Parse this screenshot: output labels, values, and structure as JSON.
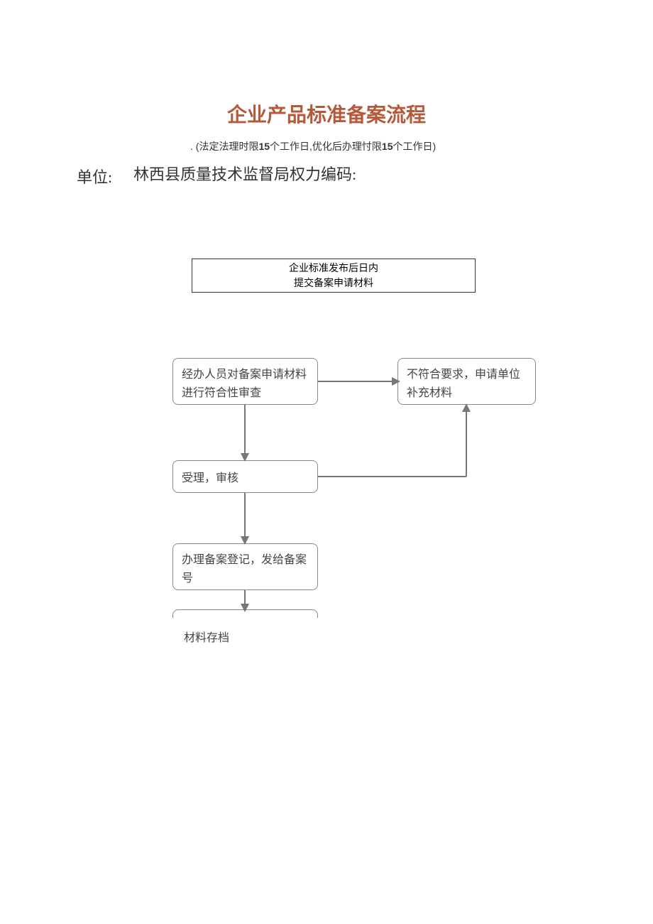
{
  "title": "企业产品标准备案流程",
  "subtitle_prefix": ". (法定法理时限",
  "subtitle_days1": "15",
  "subtitle_mid": "个工作日,优化后办理忖限",
  "subtitle_days2": "15",
  "subtitle_suffix": "个工作日)",
  "danwei_label": "单位:",
  "danwei_value": "林西县质量技术监督局权力编码:",
  "start_box_line1": "企业标准发布后日内",
  "start_box_line2": "提交备案申请材料",
  "box_review": "经办人员对备案申请材料进行符合性审查",
  "box_reject": "不符合要求，申请单位补充材料",
  "box_accept": "受理，审核",
  "box_process": "办理备案登记，发给备案号",
  "archive_label": "材料存档"
}
